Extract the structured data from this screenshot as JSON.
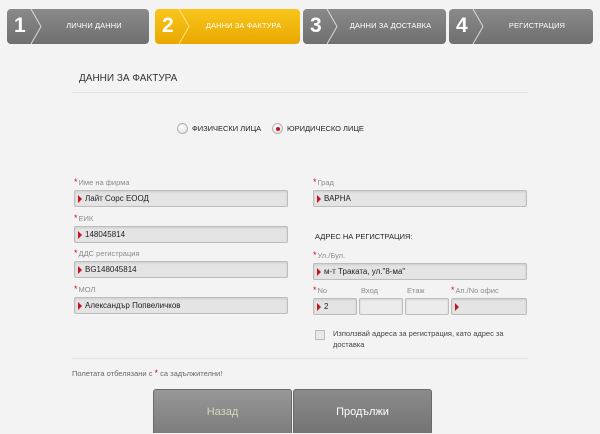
{
  "steps": [
    {
      "num": "1",
      "label": "Лични данни",
      "active": false
    },
    {
      "num": "2",
      "label": "Данни за фактура",
      "active": true
    },
    {
      "num": "3",
      "label": "Данни за доставка",
      "active": false
    },
    {
      "num": "4",
      "label": "Регистрация",
      "active": false
    }
  ],
  "section_title": "ДАННИ ЗА ФАКТУРА",
  "person_type": {
    "options": [
      {
        "label": "ФИЗИЧЕСКИ ЛИЦА",
        "selected": false
      },
      {
        "label": "ЮРИДИЧЕСКО ЛИЦЕ",
        "selected": true
      }
    ]
  },
  "fields": {
    "company_name": {
      "label": "Име на фирма",
      "value": "Лайт Сорс ЕООД"
    },
    "eik": {
      "label": "ЕИК",
      "value": "148045814"
    },
    "vat": {
      "label": "ДДС регистрация",
      "value": "BG148045814"
    },
    "mol": {
      "label": "МОЛ",
      "value": "Александър Попвеличков"
    },
    "city": {
      "label": "Град",
      "value": "ВАРНА"
    },
    "street": {
      "label": "Ул./Бул.",
      "value": "м-т Траката, ул.\"8-ма\""
    },
    "no": {
      "label": "No",
      "value": "2"
    },
    "entrance": {
      "label": "Вход",
      "value": ""
    },
    "floor": {
      "label": "Етаж",
      "value": ""
    },
    "apt": {
      "label": "Ап./No офис",
      "value": ""
    }
  },
  "address_heading": "АДРЕС НА РЕГИСТРАЦИЯ:",
  "use_reg_address_label": "Използвай адреса за регистрация, като адрес за доставка",
  "required_note": {
    "before": "Полетата отбелязани с",
    "after": "са задължителни!"
  },
  "buttons": {
    "back": "Назад",
    "next": "Продължи"
  },
  "colors": {
    "accent": "#f5b800",
    "required": "#c4161c"
  }
}
